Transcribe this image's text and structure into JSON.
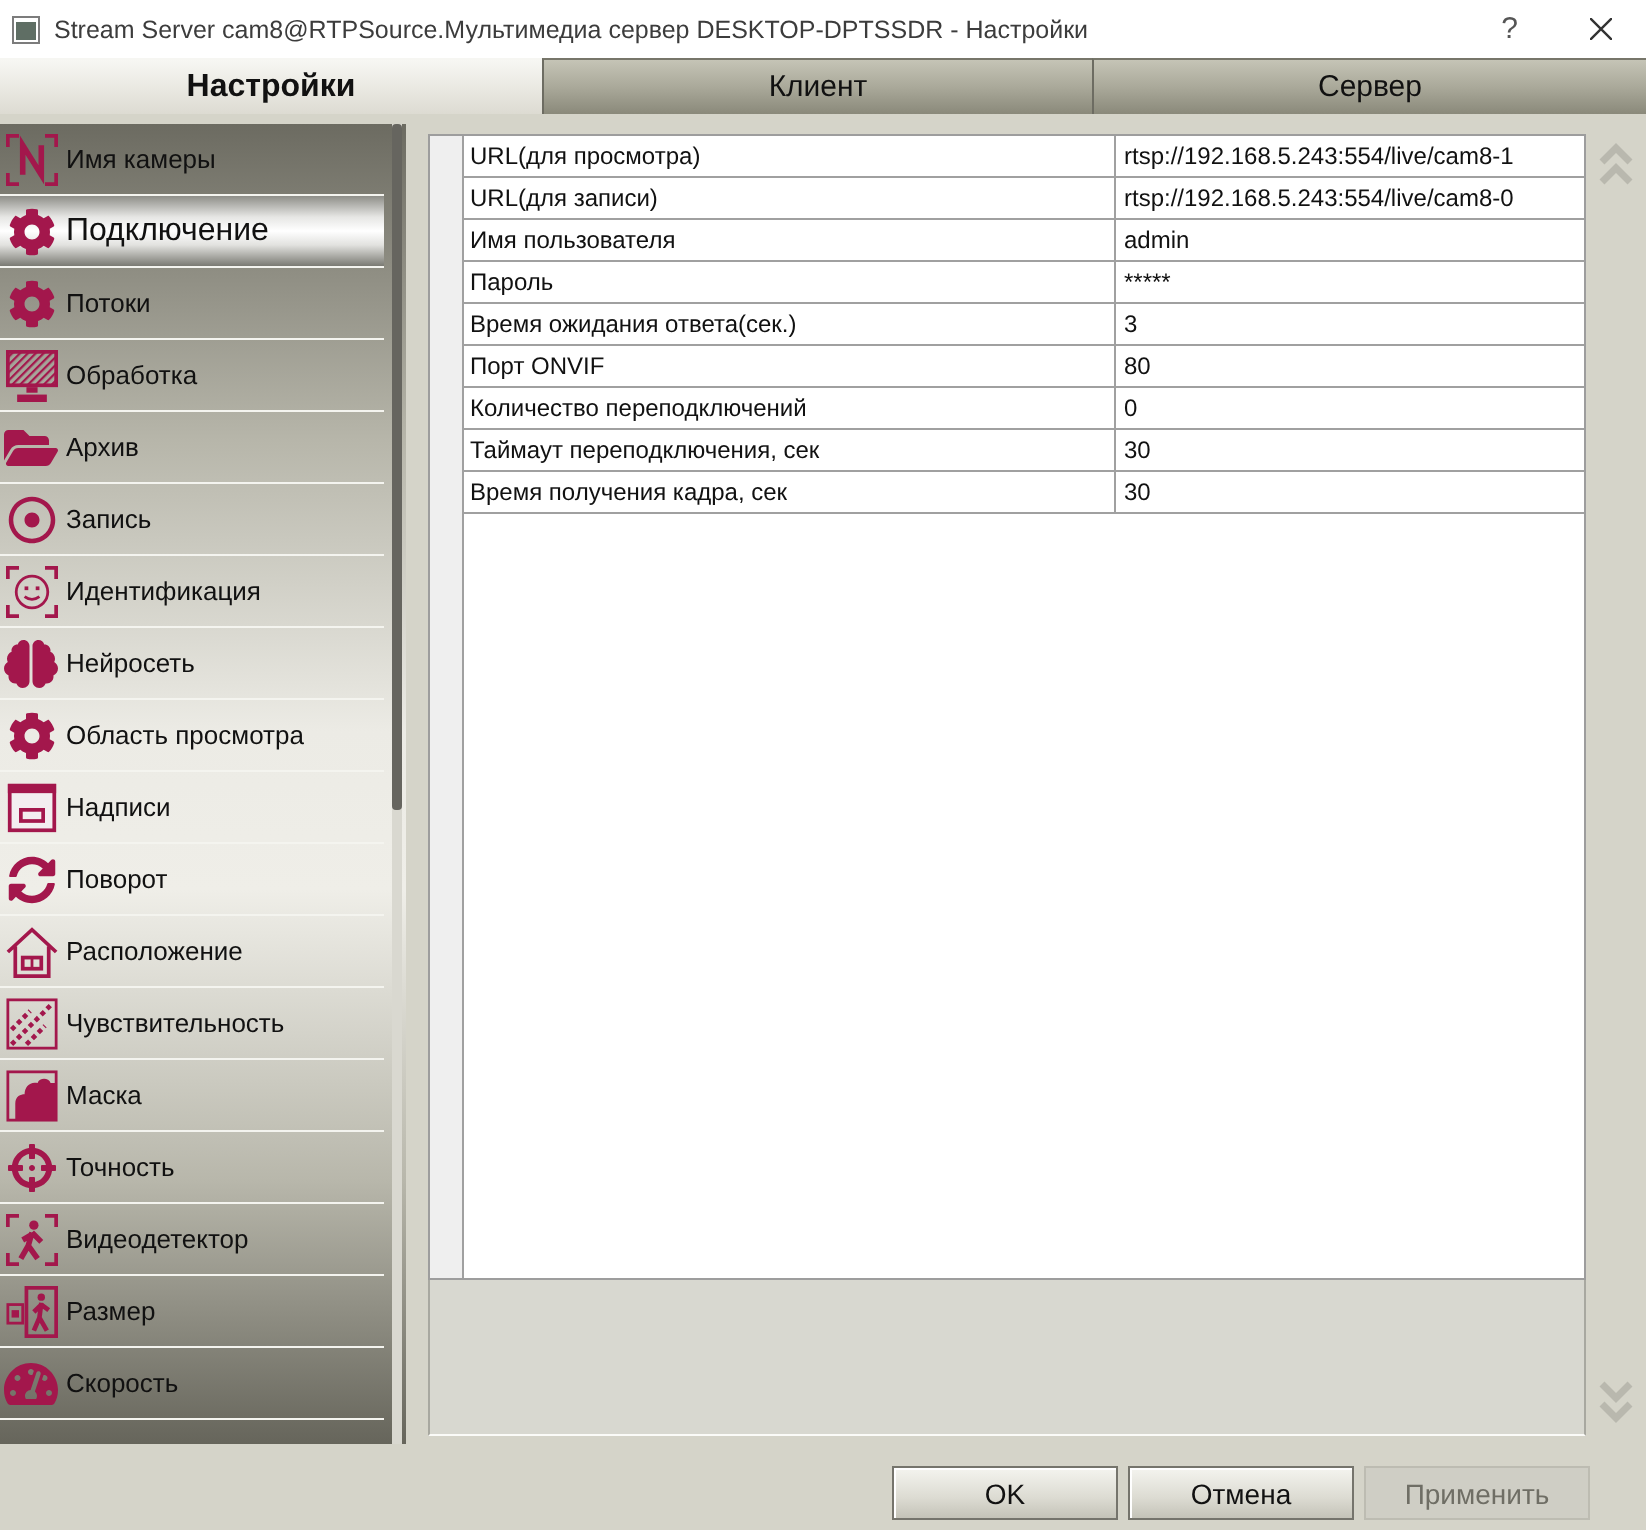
{
  "window": {
    "title": "Stream Server cam8@RTPSource.Мультимедиа сервер DESKTOP-DPTSSDR - Настройки",
    "help": "?"
  },
  "tabs": [
    {
      "label": "Настройки",
      "selected": true
    },
    {
      "label": "Клиент",
      "selected": false
    },
    {
      "label": "Сервер",
      "selected": false
    }
  ],
  "sidebar": {
    "items": [
      {
        "label": "Имя камеры",
        "selected": false
      },
      {
        "label": "Подключение",
        "selected": true
      },
      {
        "label": "Потоки",
        "selected": false
      },
      {
        "label": "Обработка",
        "selected": false
      },
      {
        "label": "Архив",
        "selected": false
      },
      {
        "label": "Запись",
        "selected": false
      },
      {
        "label": "Идентификация",
        "selected": false
      },
      {
        "label": "Нейросеть",
        "selected": false
      },
      {
        "label": "Область просмотра",
        "selected": false
      },
      {
        "label": "Надписи",
        "selected": false
      },
      {
        "label": "Поворот",
        "selected": false
      },
      {
        "label": "Расположение",
        "selected": false
      },
      {
        "label": "Чувствительность",
        "selected": false
      },
      {
        "label": "Маска",
        "selected": false
      },
      {
        "label": "Точность",
        "selected": false
      },
      {
        "label": "Видеодетектор",
        "selected": false
      },
      {
        "label": "Размер",
        "selected": false
      },
      {
        "label": "Скорость",
        "selected": false
      }
    ]
  },
  "properties": {
    "rows": [
      {
        "name": "URL(для просмотра)",
        "value": "rtsp://192.168.5.243:554/live/cam8-1"
      },
      {
        "name": "URL(для записи)",
        "value": "rtsp://192.168.5.243:554/live/cam8-0"
      },
      {
        "name": "Имя пользователя",
        "value": "admin"
      },
      {
        "name": "Пароль",
        "value": "*****"
      },
      {
        "name": "Время ожидания ответа(сек.)",
        "value": "3"
      },
      {
        "name": "Порт ONVIF",
        "value": "80"
      },
      {
        "name": "Количество переподключений",
        "value": "0"
      },
      {
        "name": "Таймаут переподключения, сек",
        "value": "30"
      },
      {
        "name": "Время получения кадра, сек",
        "value": "30"
      }
    ]
  },
  "buttons": [
    {
      "label": "OK",
      "disabled": false
    },
    {
      "label": "Отмена",
      "disabled": false
    },
    {
      "label": "Применить",
      "disabled": true
    }
  ]
}
